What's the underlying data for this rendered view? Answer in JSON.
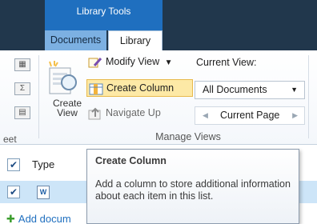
{
  "header": {
    "tools_label": "Library Tools",
    "tabs": [
      {
        "label": "Documents",
        "active": false
      },
      {
        "label": "Library",
        "active": true
      }
    ]
  },
  "ribbon": {
    "left_group_label": "eet",
    "create_view_label": "Create View",
    "modify_view_label": "Modify View",
    "create_column_label": "Create Column",
    "navigate_up_label": "Navigate Up",
    "current_view_label": "Current View:",
    "current_view_value": "All Documents",
    "current_page_label": "Current Page",
    "group_label": "Manage Views",
    "colors": {
      "top_band": "#21374c",
      "tools_banner": "#1f6fbf",
      "highlight": "#fde9a6"
    }
  },
  "list": {
    "type_header": "Type",
    "add_document_label": "Add docum",
    "selected_row_color": "#cde5f8"
  },
  "tooltip": {
    "title": "Create Column",
    "body": "Add a column to store additional information about each item in this list."
  }
}
